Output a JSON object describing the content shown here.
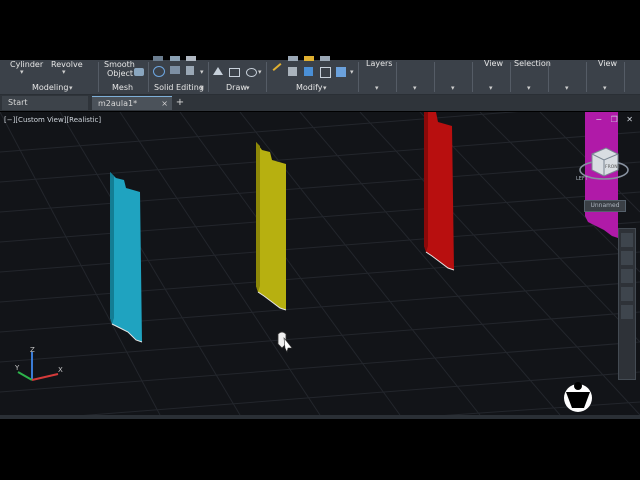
{
  "ribbon": {
    "buttons": {
      "cylinder": "Cylinder",
      "revolve": "Revolve",
      "smooth_object_1": "Smooth",
      "smooth_object_2": "Object",
      "layers": "Layers",
      "view_1": "View",
      "selection": "Selection",
      "view_2": "View"
    },
    "panels": {
      "modeling": "Modeling",
      "mesh": "Mesh",
      "solid_editing": "Solid Editing",
      "draw": "Draw",
      "modify": "Modify"
    }
  },
  "tabs": [
    {
      "label": "Start"
    },
    {
      "label": "m2aula1*",
      "close": "×"
    }
  ],
  "tab_add": "+",
  "viewport": {
    "label": "[−][Custom View][Realistic]",
    "window_buttons": "− ❐ ✕",
    "viewcube_face": "FRONT",
    "viewcube_side": "LEFT",
    "wcs_label": "Unnamed"
  },
  "colors": {
    "ribbon_bg": "#3b4149",
    "viewport_bg": "#121418",
    "cyan_panel": "#1fa3c0",
    "yellow_panel": "#b7b010",
    "red_panel": "#b80f0f",
    "magenta_panel": "#b01aa8"
  },
  "icons": [
    "cylinder-icon",
    "revolve-icon",
    "smooth-object-icon",
    "layers-icon",
    "view-icon",
    "selection-icon",
    "hand-cursor-icon",
    "ucs-icon",
    "viewcube-icon",
    "logo-icon"
  ]
}
